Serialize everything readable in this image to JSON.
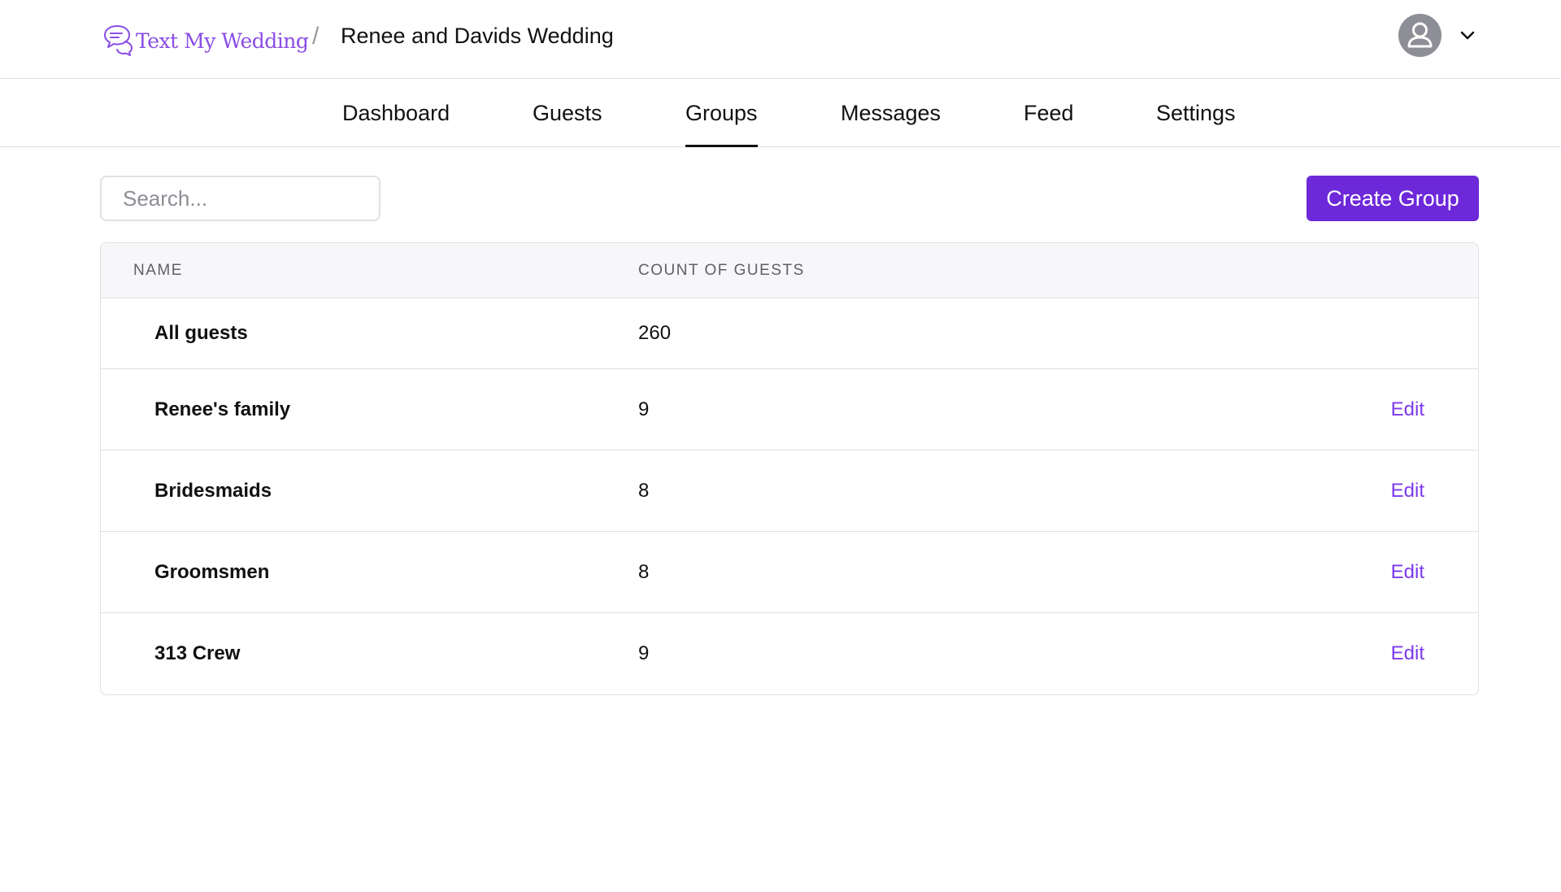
{
  "header": {
    "brand_name": "Text My Wedding",
    "breadcrumb_separator": "/",
    "event_title": "Renee and Davids Wedding"
  },
  "nav": {
    "tabs": [
      {
        "label": "Dashboard",
        "active": false
      },
      {
        "label": "Guests",
        "active": false
      },
      {
        "label": "Groups",
        "active": true
      },
      {
        "label": "Messages",
        "active": false
      },
      {
        "label": "Feed",
        "active": false
      },
      {
        "label": "Settings",
        "active": false
      }
    ]
  },
  "toolbar": {
    "search_placeholder": "Search...",
    "search_value": "",
    "create_label": "Create Group"
  },
  "table": {
    "headers": {
      "name": "NAME",
      "count": "COUNT OF GUESTS"
    },
    "rows": [
      {
        "name": "All guests",
        "count": "260",
        "action": ""
      },
      {
        "name": "Renee's family",
        "count": "9",
        "action": "Edit"
      },
      {
        "name": "Bridesmaids",
        "count": "8",
        "action": "Edit"
      },
      {
        "name": "Groomsmen",
        "count": "8",
        "action": "Edit"
      },
      {
        "name": "313 Crew",
        "count": "9",
        "action": "Edit"
      }
    ]
  },
  "colors": {
    "brand": "#8a4de6",
    "primary_button": "#6d28d9",
    "link": "#7c3aed",
    "avatar_bg": "#8e8e96"
  },
  "icons": {
    "logo": "chat-bubbles-icon",
    "avatar": "user-icon",
    "account_menu": "chevron-down-icon"
  }
}
